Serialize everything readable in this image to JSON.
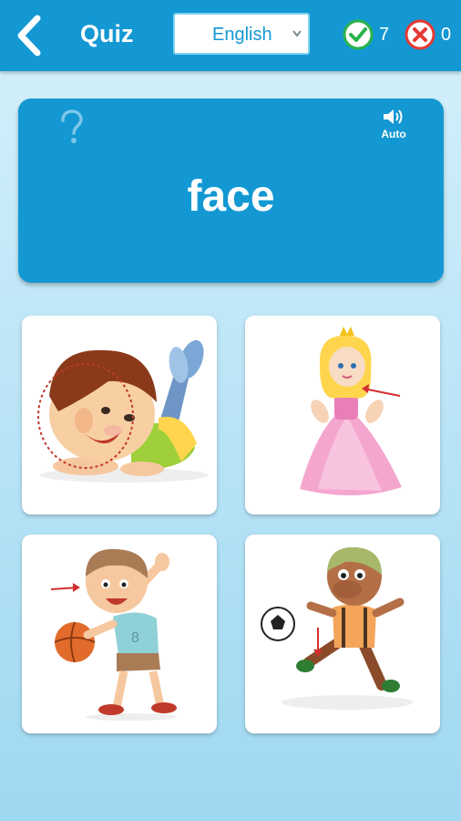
{
  "header": {
    "title": "Quiz",
    "back_icon": "chevron-left-icon",
    "language": {
      "selected": "English"
    },
    "score": {
      "correct": "7",
      "wrong": "0"
    }
  },
  "word_card": {
    "word": "face",
    "help_icon": "question-mark-icon",
    "audio": {
      "icon": "speaker-icon",
      "label": "Auto"
    }
  },
  "answers": [
    {
      "subject": "boy lying on stomach, face circled with dotted line"
    },
    {
      "subject": "princess in pink dress, arrow pointing at face"
    },
    {
      "subject": "boy playing basketball, arrow pointing at face"
    },
    {
      "subject": "boy kicking soccer ball, arrow pointing at foot"
    }
  ],
  "colors": {
    "primary": "#1398d3",
    "background": "#b7e3f6",
    "correct": "#2bb34a",
    "wrong": "#e53935"
  }
}
